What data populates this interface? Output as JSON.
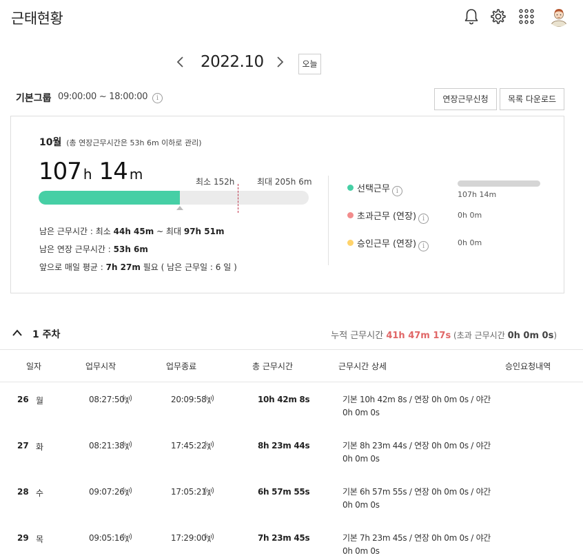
{
  "header": {
    "title": "근태현황",
    "icons": [
      "bell-icon",
      "gear-icon",
      "apps-grid-icon"
    ]
  },
  "month_nav": {
    "month": "2022.10",
    "today_label": "오늘"
  },
  "group": {
    "name": "기본그룹",
    "time_range": "09:00:00 ~ 18:00:00",
    "info": "i",
    "extension_button": "연장근무신청",
    "download_button": "목록 다운로드"
  },
  "summary": {
    "month_title": "10월",
    "month_note": "(총 연장근무시간은 53h 6m 이하로 관리)",
    "total_hours": "107",
    "hours_unit": "h",
    "total_minutes": "14",
    "minutes_unit": "m",
    "min_label": "최소 152h",
    "max_label": "최대 205h 6m",
    "progress_fraction": 0.523,
    "remaining_prefix": "남은 근무시간 : 최소 ",
    "remaining_min": "44h 45m",
    "remaining_mid": " ~ 최대 ",
    "remaining_max": "97h 51m",
    "remaining_ext_prefix": "남은 연장 근무시간 : ",
    "remaining_ext": "53h 6m",
    "daily_prefix": "앞으로 매일 평균 : ",
    "daily_avg": "7h 27m",
    "daily_suffix": " 필요 ( 남은 근무일 : 6 일 )",
    "legend": [
      {
        "label": "선택근무",
        "value": "107h 14m",
        "color": "#46cfa5"
      },
      {
        "label": "초과근무 (연장)",
        "value": "0h 0m",
        "color": "#f28c8c"
      },
      {
        "label": "승인근무 (연장)",
        "value": "0h 0m",
        "color": "#ffd36b"
      }
    ]
  },
  "week": {
    "label": "1 주차",
    "cum_prefix": "누적 근무시간 ",
    "cum_value": "41h 47m 17s",
    "over_prefix": " (초과 근무시간 ",
    "over_value": "0h 0m 0s",
    "over_suffix": ")"
  },
  "table": {
    "headers": [
      "일자",
      "업무시작",
      "업무종료",
      "총 근무시간",
      "근무시간 상세",
      "승인요청내역"
    ],
    "rows": [
      {
        "day": "26",
        "weekday": "월",
        "start": "08:27:50",
        "end": "20:09:58",
        "total": "10h 42m 8s",
        "detail": "기본 10h 42m 8s / 연장 0h 0m 0s / 야간 0h 0m 0s"
      },
      {
        "day": "27",
        "weekday": "화",
        "start": "08:21:38",
        "end": "17:45:22",
        "total": "8h 23m 44s",
        "detail": "기본 8h 23m 44s / 연장 0h 0m 0s / 야간 0h 0m 0s"
      },
      {
        "day": "28",
        "weekday": "수",
        "start": "09:07:26",
        "end": "17:05:21",
        "total": "6h 57m 55s",
        "detail": "기본 6h 57m 55s / 연장 0h 0m 0s / 야간 0h 0m 0s"
      },
      {
        "day": "29",
        "weekday": "목",
        "start": "09:05:16",
        "end": "17:29:00",
        "total": "7h 23m 45s",
        "detail": "기본 7h 23m 45s / 연장 0h 0m 0s / 야간 0h 0m 0s"
      }
    ]
  }
}
